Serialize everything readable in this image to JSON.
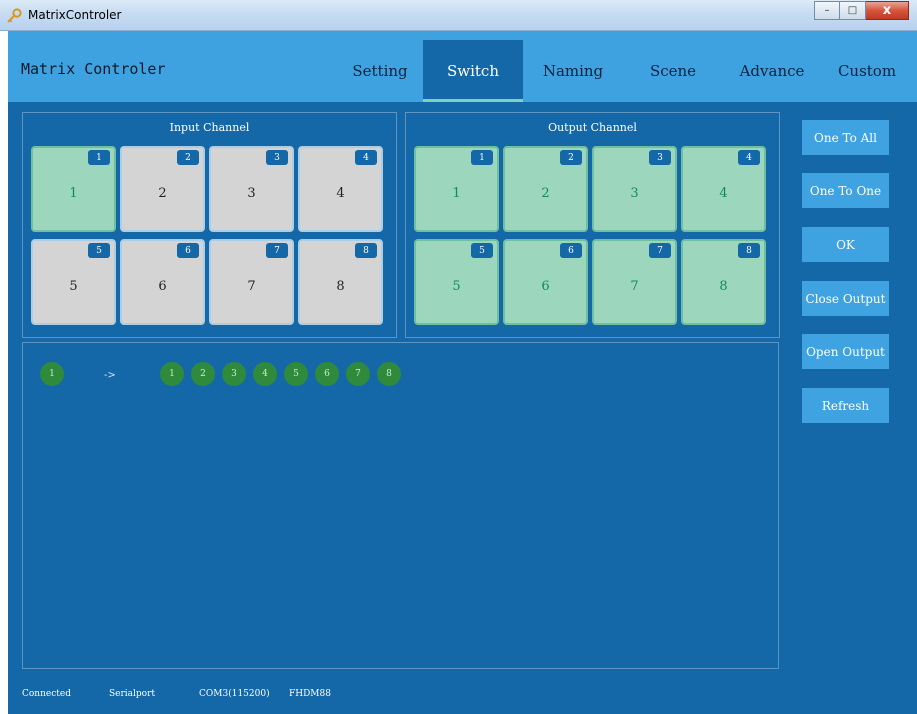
{
  "window": {
    "title": "MatrixControler",
    "controls": {
      "minimize": "–",
      "maximize": "□",
      "close": "x"
    }
  },
  "header": {
    "app_title": "Matrix Controler",
    "tabs": [
      "Setting",
      "Switch",
      "Naming",
      "Scene",
      "Advance",
      "Custom"
    ],
    "active_tab": "Switch"
  },
  "input_panel": {
    "title": "Input Channel",
    "tiles": [
      {
        "badge": "1",
        "label": "1",
        "selected": true
      },
      {
        "badge": "2",
        "label": "2",
        "selected": false
      },
      {
        "badge": "3",
        "label": "3",
        "selected": false
      },
      {
        "badge": "4",
        "label": "4",
        "selected": false
      },
      {
        "badge": "5",
        "label": "5",
        "selected": false
      },
      {
        "badge": "6",
        "label": "6",
        "selected": false
      },
      {
        "badge": "7",
        "label": "7",
        "selected": false
      },
      {
        "badge": "8",
        "label": "8",
        "selected": false
      }
    ]
  },
  "output_panel": {
    "title": "Output Channel",
    "tiles": [
      {
        "badge": "1",
        "label": "1",
        "selected": true
      },
      {
        "badge": "2",
        "label": "2",
        "selected": true
      },
      {
        "badge": "3",
        "label": "3",
        "selected": true
      },
      {
        "badge": "4",
        "label": "4",
        "selected": true
      },
      {
        "badge": "5",
        "label": "5",
        "selected": true
      },
      {
        "badge": "6",
        "label": "6",
        "selected": true
      },
      {
        "badge": "7",
        "label": "7",
        "selected": true
      },
      {
        "badge": "8",
        "label": "8",
        "selected": true
      }
    ]
  },
  "mapping": {
    "input": "1",
    "arrow": "->",
    "outputs": [
      "1",
      "2",
      "3",
      "4",
      "5",
      "6",
      "7",
      "8"
    ]
  },
  "side_buttons": [
    "One To All",
    "One To One",
    "OK",
    "Close Output",
    "Open Output",
    "Refresh"
  ],
  "status": {
    "connection": "Connected",
    "port_type": "Serialport",
    "port": "COM3(115200)",
    "device": "FHDM88"
  },
  "colors": {
    "header_bg": "#3ea1e0",
    "app_bg": "#1568a8",
    "tile_selected": "#9bd6bd",
    "tile_idle": "#d4d4d4",
    "mapping_dot": "#2f8a3b"
  }
}
